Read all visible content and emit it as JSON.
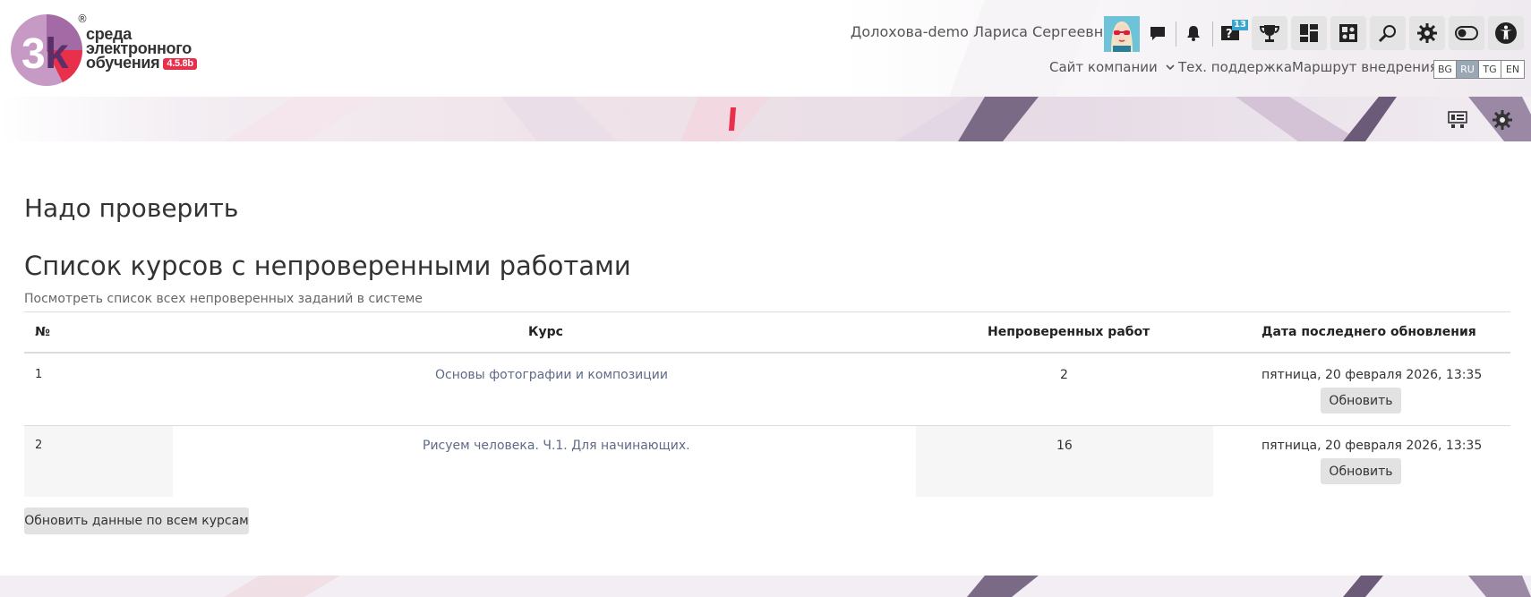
{
  "header": {
    "logo": {
      "line1": "среда",
      "line2": "электронного",
      "line3": "обучения",
      "version": "4.5.8b",
      "registered": "®"
    },
    "user_name": "Долохова-demo Лариса Сергеевна",
    "question_badge": "13",
    "icons": [
      "chat-icon",
      "bell-icon",
      "question-icon",
      "trophy-icon",
      "dashboard-icon",
      "puzzle-icon",
      "search-icon",
      "gear-icon",
      "toggle-icon",
      "accessibility-icon"
    ],
    "nav": {
      "company_site": "Сайт компании",
      "support": "Тех. поддержка",
      "route": "Маршрут внедрения"
    },
    "languages": [
      "BG",
      "RU",
      "TG",
      "EN"
    ],
    "active_language": "RU"
  },
  "band_tools": [
    "block-config-icon",
    "settings-gear-icon"
  ],
  "main": {
    "page_title": "Надо проверить",
    "section_title": "Список курсов с непроверенными работами",
    "all_link": "Посмотреть список всех непроверенных заданий в системе",
    "table": {
      "headers": [
        "№",
        "Курс",
        "Непроверенных работ",
        "Дата последнего обновления"
      ],
      "rows": [
        {
          "num": "1",
          "course": "Основы фотографии и композиции",
          "count": "2",
          "date": "пятница, 20 февраля 2026, 13:35",
          "button": "Обновить"
        },
        {
          "num": "2",
          "course": "Рисуем человека. Ч.1. Для начинающих.",
          "count": "16",
          "date": "пятница, 20 февраля 2026, 13:35",
          "button": "Обновить"
        }
      ]
    },
    "refresh_all": "Обновить данные по всем курсам"
  },
  "colors": {
    "brand_purple": "#8b5a9e",
    "brand_red": "#e8304a",
    "link": "#5f6b86",
    "button_bg": "#e2e2e2",
    "active_lang": "#9aa7b4"
  }
}
